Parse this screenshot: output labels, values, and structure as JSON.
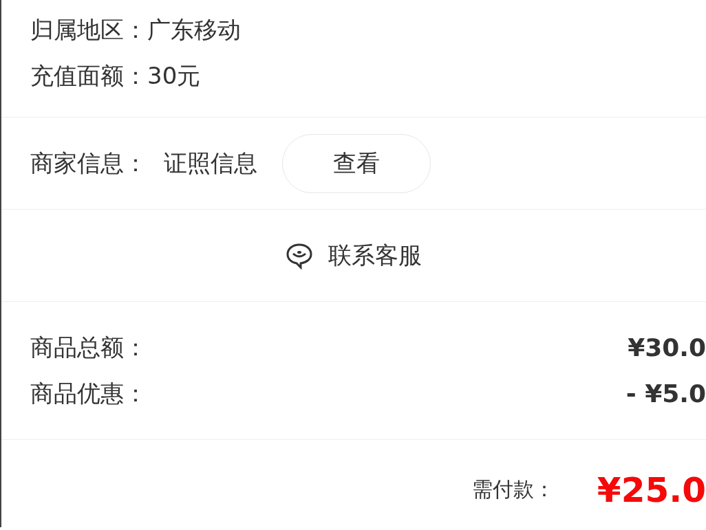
{
  "order_info": [
    {
      "label": "归属地区：",
      "value": "广东移动"
    },
    {
      "label": "充值面额：",
      "value": "30元"
    }
  ],
  "merchant": {
    "label": "商家信息：",
    "value": "证照信息",
    "button": "查看"
  },
  "contact": {
    "label": "联系客服"
  },
  "summary": [
    {
      "label": "商品总额：",
      "amount": "¥30.0"
    },
    {
      "label": "商品优惠：",
      "amount": "- ¥5.0"
    }
  ],
  "payment": {
    "label": "需付款：",
    "amount": "¥25.0"
  }
}
